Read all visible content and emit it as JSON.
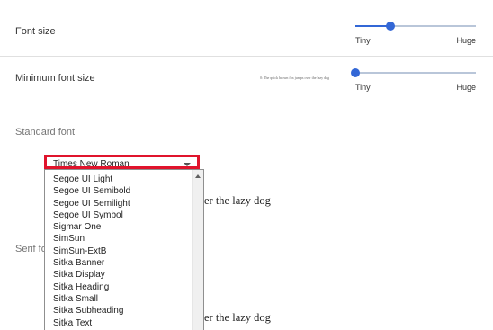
{
  "font_size": {
    "label": "Font size",
    "min_label": "Tiny",
    "max_label": "Huge",
    "value_fraction": 0.29
  },
  "min_font_size": {
    "label": "Minimum font size",
    "sample": "0: The quick brown fox jumps over the lazy dog",
    "min_label": "Tiny",
    "max_label": "Huge",
    "value_fraction": 0.0
  },
  "standard_font": {
    "heading": "Standard font",
    "selected": "Times New Roman",
    "sample": "er the lazy dog",
    "options": [
      "Segoe UI Light",
      "Segoe UI Semibold",
      "Segoe UI Semilight",
      "Segoe UI Symbol",
      "Sigmar One",
      "SimSun",
      "SimSun-ExtB",
      "Sitka Banner",
      "Sitka Display",
      "Sitka Heading",
      "Sitka Small",
      "Sitka Subheading",
      "Sitka Text"
    ]
  },
  "serif_font": {
    "heading": "Serif fo",
    "sample": "er the lazy dog"
  },
  "colors": {
    "accent": "#3367d6",
    "highlight_box": "#e0142c"
  }
}
